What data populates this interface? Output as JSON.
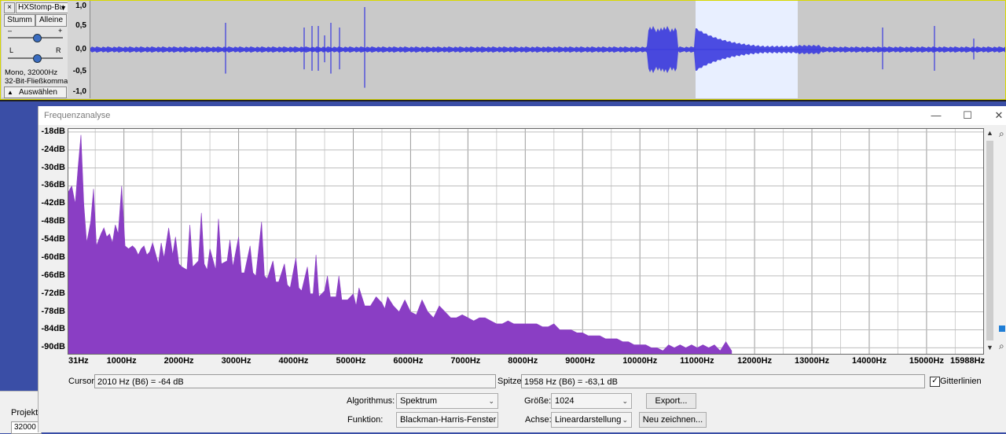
{
  "track": {
    "name": "HXStomp-Bu",
    "mute_label": "Stumm",
    "solo_label": "Alleine",
    "gain_minus": "–",
    "gain_plus": "+",
    "pan_left": "L",
    "pan_right": "R",
    "format_line1": "Mono, 32000Hz",
    "format_line2": "32-Bit-Fließkomma",
    "select_label": "Auswählen",
    "close_glyph": "×",
    "ruler": [
      "1,0",
      "0,5",
      "0,0",
      "-0,5",
      "-1,0"
    ],
    "wave_color": "#3a3adf",
    "selection_color": "#e8efff"
  },
  "dialog": {
    "title": "Frequenzanalyse",
    "minimize": "—",
    "maximize": "☐",
    "close": "✕",
    "cursor_label": "Cursor:",
    "cursor_value": "2010 Hz (B6) = -64 dB",
    "peak_label": "Spitze:",
    "peak_value": "1958 Hz (B6) = -63,1 dB",
    "grid_label": "Gitterlinien",
    "grid_checked": true,
    "algorithm_label": "Algorithmus:",
    "algorithm_value": "Spektrum",
    "size_label": "Größe:",
    "size_value": "1024",
    "export_label": "Export...",
    "function_label": "Funktion:",
    "function_value": "Blackman-Harris-Fenster",
    "axis_label": "Achse:",
    "axis_value": "Lineardarstellung",
    "redraw_label": "Neu zeichnen..."
  },
  "background": {
    "project_label": "Projekt",
    "rate_value": "32000"
  },
  "chart_data": {
    "type": "area",
    "color": "#8a3ec4",
    "grid": true,
    "y_ticks": [
      "-18dB",
      "-24dB",
      "-30dB",
      "-36dB",
      "-42dB",
      "-48dB",
      "-54dB",
      "-60dB",
      "-66dB",
      "-72dB",
      "-78dB",
      "-84dB",
      "-90dB"
    ],
    "x_ticks": [
      "31Hz",
      "1000Hz",
      "2000Hz",
      "3000Hz",
      "4000Hz",
      "5000Hz",
      "6000Hz",
      "7000Hz",
      "8000Hz",
      "9000Hz",
      "10000Hz",
      "11000Hz",
      "12000Hz",
      "13000Hz",
      "14000Hz",
      "15000Hz",
      "15988Hz"
    ],
    "xlim": [
      31,
      15988
    ],
    "ylim": [
      -92,
      -17
    ],
    "x": [
      31,
      90,
      150,
      200,
      250,
      300,
      350,
      420,
      470,
      520,
      560,
      600,
      650,
      700,
      750,
      800,
      850,
      900,
      960,
      1020,
      1080,
      1150,
      1200,
      1250,
      1300,
      1350,
      1400,
      1450,
      1500,
      1600,
      1650,
      1700,
      1780,
      1850,
      1900,
      1958,
      2010,
      2100,
      2150,
      2200,
      2300,
      2350,
      2400,
      2450,
      2500,
      2600,
      2650,
      2700,
      2800,
      2850,
      2900,
      3000,
      3050,
      3100,
      3200,
      3250,
      3300,
      3400,
      3450,
      3500,
      3600,
      3650,
      3700,
      3800,
      3850,
      3900,
      4000,
      4050,
      4100,
      4200,
      4250,
      4300,
      4350,
      4400,
      4500,
      4550,
      4600,
      4700,
      4750,
      4800,
      4900,
      5000,
      5050,
      5100,
      5200,
      5300,
      5400,
      5500,
      5550,
      5600,
      5700,
      5800,
      5900,
      6000,
      6100,
      6200,
      6300,
      6400,
      6500,
      6600,
      6700,
      6800,
      6900,
      7000,
      7100,
      7200,
      7300,
      7400,
      7500,
      7600,
      7700,
      7800,
      7900,
      8000,
      8100,
      8200,
      8300,
      8400,
      8500,
      8600,
      8700,
      8800,
      8900,
      9000,
      9100,
      9200,
      9300,
      9400,
      9500,
      9600,
      9700,
      9800,
      9900,
      10000,
      10100,
      10200,
      10300,
      10400,
      10500,
      10600,
      10700,
      10800,
      10900,
      11000,
      11100,
      11200,
      11300,
      11400,
      11500,
      11600
    ],
    "values": [
      -38,
      -36,
      -42,
      -30,
      -19,
      -42,
      -55,
      -48,
      -37,
      -56,
      -54,
      -52,
      -50,
      -53,
      -52,
      -55,
      -49,
      -52,
      -36,
      -56,
      -57,
      -56,
      -57,
      -59,
      -57,
      -56,
      -59,
      -58,
      -55,
      -62,
      -55,
      -60,
      -50,
      -59,
      -53,
      -62,
      -63,
      -64,
      -49,
      -63,
      -61,
      -45,
      -62,
      -64,
      -57,
      -64,
      -47,
      -62,
      -61,
      -54,
      -63,
      -53,
      -65,
      -65,
      -56,
      -65,
      -66,
      -48,
      -66,
      -67,
      -61,
      -68,
      -68,
      -62,
      -69,
      -70,
      -60,
      -70,
      -71,
      -63,
      -72,
      -72,
      -59,
      -73,
      -71,
      -66,
      -73,
      -73,
      -66,
      -74,
      -74,
      -72,
      -76,
      -70,
      -76,
      -76,
      -73,
      -75,
      -77,
      -73,
      -76,
      -78,
      -74,
      -78,
      -79,
      -74,
      -78,
      -80,
      -76,
      -78,
      -80,
      -80,
      -79,
      -80,
      -81,
      -80,
      -80,
      -81,
      -82,
      -82,
      -81,
      -82,
      -82,
      -82,
      -82,
      -82,
      -83,
      -83,
      -82,
      -84,
      -84,
      -84,
      -85,
      -85,
      -86,
      -86,
      -86,
      -87,
      -87,
      -87,
      -88,
      -88,
      -89,
      -89,
      -89,
      -90,
      -90,
      -91,
      -89,
      -90,
      -89,
      -90,
      -89,
      -90,
      -89,
      -90,
      -89,
      -91,
      -88,
      -91,
      -92
    ]
  }
}
